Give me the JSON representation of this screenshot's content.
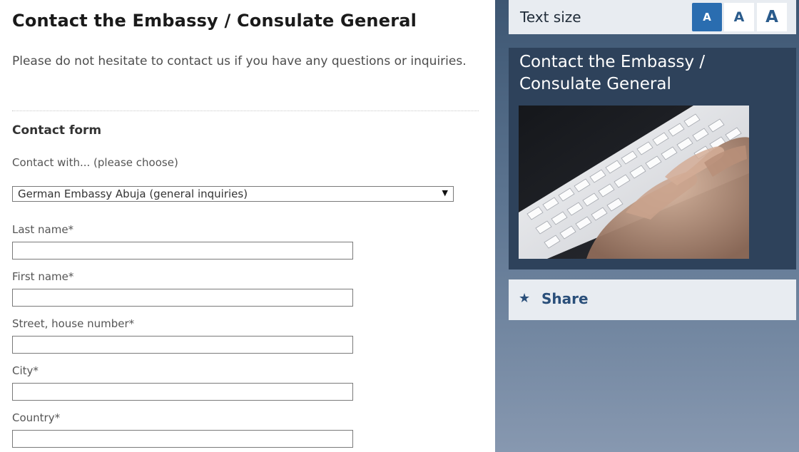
{
  "main": {
    "title": "Contact the Embassy / Consulate General",
    "intro": "Please do not hesitate to contact us if you have any questions or inquiries.",
    "form_heading": "Contact form",
    "select_label": "Contact with... (please choose)",
    "select_value": "German Embassy Abuja (general inquiries)",
    "fields": [
      {
        "label": "Last name*",
        "value": ""
      },
      {
        "label": "First name*",
        "value": ""
      },
      {
        "label": "Street, house number*",
        "value": ""
      },
      {
        "label": "City*",
        "value": ""
      },
      {
        "label": "Country*",
        "value": ""
      }
    ]
  },
  "sidebar": {
    "text_size_label": "Text size",
    "text_size_options": [
      "A",
      "A",
      "A"
    ],
    "text_size_active": 0,
    "teaser_title": "Contact the Embassy / Consulate General",
    "share_label": "Share",
    "share_icon": "star-icon"
  },
  "colors": {
    "accent": "#2a6db0",
    "sidebar_dark": "#2e425b",
    "link": "#2a4f7a"
  }
}
